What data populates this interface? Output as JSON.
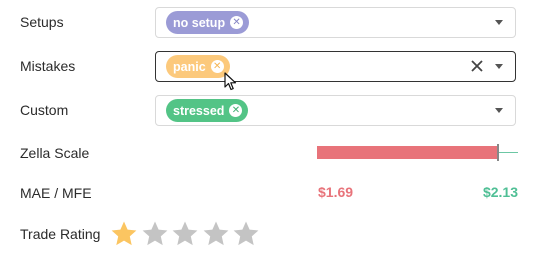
{
  "setups": {
    "label": "Setups",
    "chips": [
      {
        "text": "no setup",
        "color": "#9b9bd6",
        "close_color": "#8585c4"
      }
    ]
  },
  "mistakes": {
    "label": "Mistakes",
    "chips": [
      {
        "text": "panic",
        "color": "#fcc97c",
        "close_color": "#f5b553"
      }
    ]
  },
  "custom": {
    "label": "Custom",
    "chips": [
      {
        "text": "stressed",
        "color": "#53c486",
        "close_color": "#3fae71"
      }
    ]
  },
  "zella_scale": {
    "label": "Zella Scale",
    "fill_fraction": 0.9,
    "bar_color": "#e8737a",
    "line_color": "#6cc7a4"
  },
  "mae_mfe": {
    "label": "MAE / MFE",
    "mae": "$1.69",
    "mfe": "$2.13",
    "mae_color": "#e8737a",
    "mfe_color": "#4fbf95"
  },
  "trade_rating": {
    "label": "Trade Rating",
    "rating": 1,
    "max": 5,
    "filled_color": "#fbc561",
    "empty_color": "#c4c4c4"
  }
}
